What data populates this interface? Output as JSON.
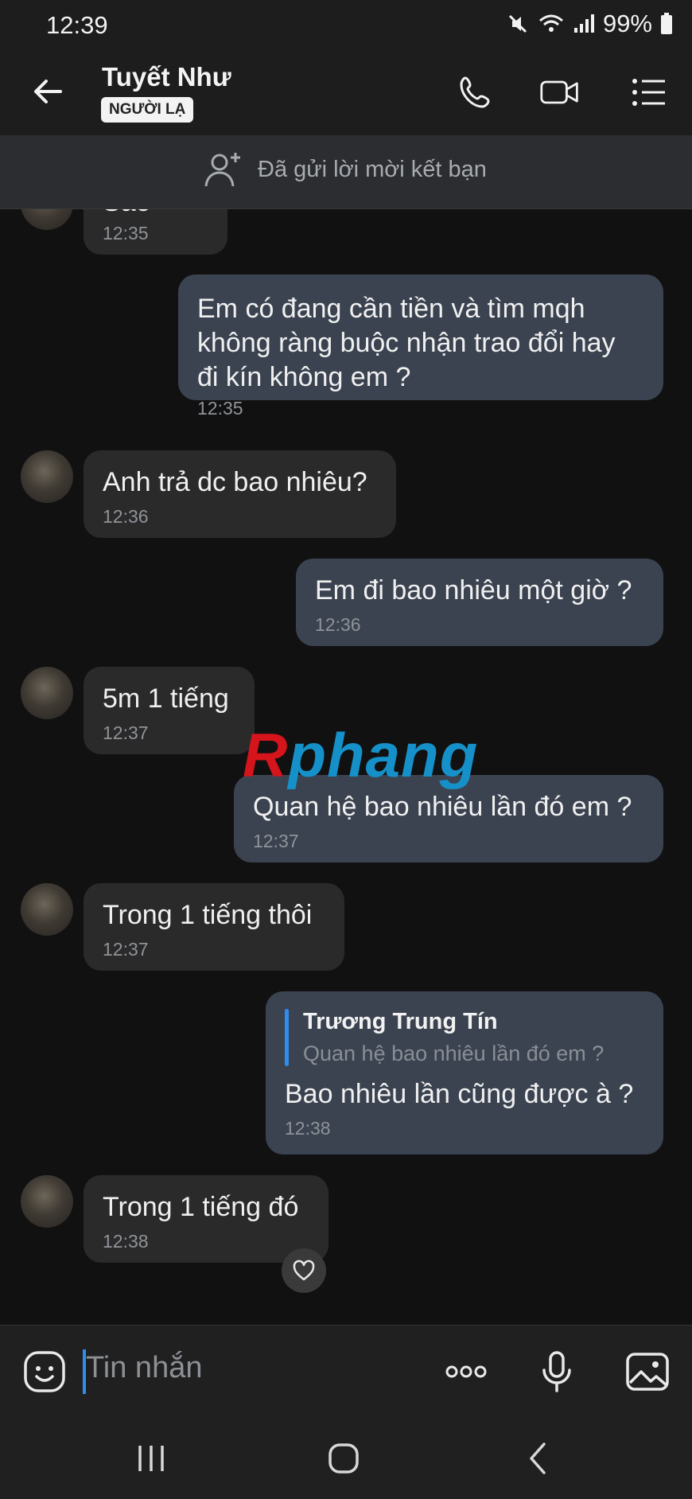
{
  "status": {
    "time": "12:39",
    "battery": "99%"
  },
  "header": {
    "name": "Tuyết Như",
    "badge": "NGƯỜI LẠ"
  },
  "friend_request": {
    "text": "Đã gửi lời mời kết bạn"
  },
  "messages": [
    {
      "direction": "in",
      "text": "Sao",
      "time": "12:35"
    },
    {
      "direction": "out",
      "text": "Em có đang cần tiền và tìm mqh\nkhông ràng buộc nhận trao đổi hay\nđi kín không em ?",
      "time": "12:35"
    },
    {
      "direction": "in",
      "text": "Anh trả dc bao nhiêu?",
      "time": "12:36"
    },
    {
      "direction": "out",
      "text": "Em đi bao nhiêu một giờ ?",
      "time": "12:36"
    },
    {
      "direction": "in",
      "text": "5m 1 tiếng",
      "time": "12:37"
    },
    {
      "direction": "out",
      "text": "Quan hệ bao nhiêu lần đó em ?",
      "time": "12:37"
    },
    {
      "direction": "in",
      "text": "Trong 1 tiếng thôi",
      "time": "12:37"
    },
    {
      "direction": "out",
      "text": "Bao nhiêu lần cũng được à ?",
      "time": "12:38",
      "reply_to": {
        "name": "Trương Trung Tín",
        "text": "Quan hệ bao nhiêu lần đó em ?"
      }
    },
    {
      "direction": "in",
      "text": "Trong 1 tiếng đó",
      "time": "12:38"
    }
  ],
  "watermark": {
    "part1": "R",
    "part2": "phang"
  },
  "composer": {
    "placeholder": "Tin nhắn"
  },
  "icons": {
    "back": "arrow-left-icon",
    "call": "phone-icon",
    "video": "video-camera-icon",
    "menu": "list-menu-icon",
    "emoji": "sticker-face-icon",
    "more": "more-dots-icon",
    "mic": "microphone-icon",
    "gallery": "image-gallery-icon",
    "heart": "heart-icon"
  }
}
